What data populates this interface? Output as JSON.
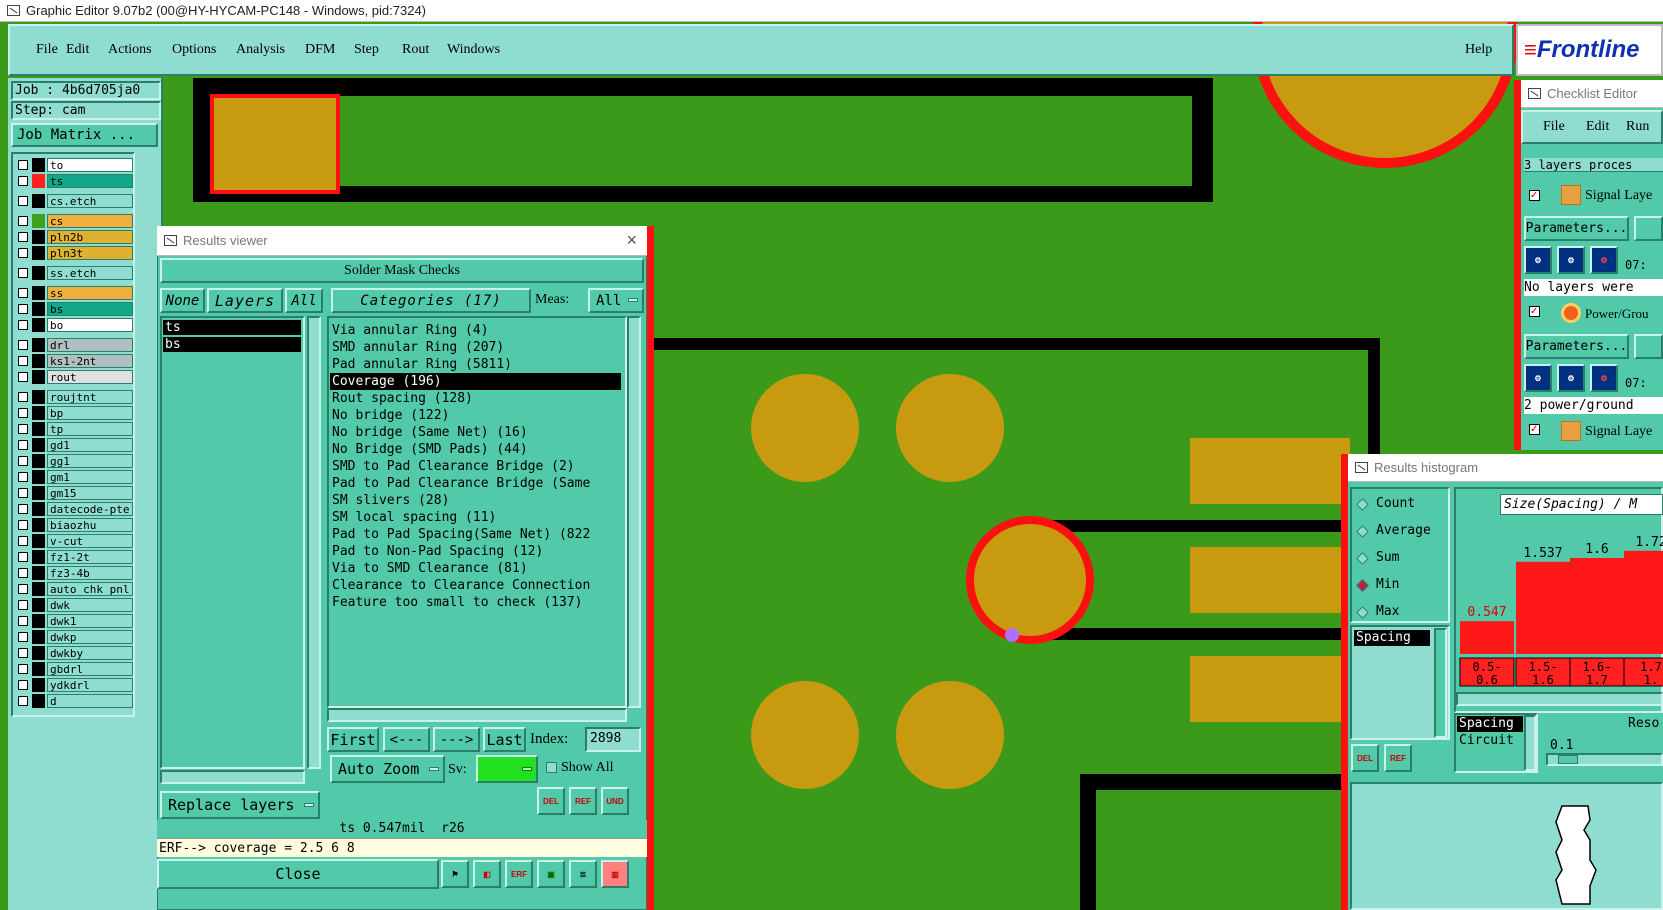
{
  "window_title": "Graphic Editor 9.07b2 (00@HY-HYCAM-PC148 - Windows, pid:7324)",
  "menu": [
    "File",
    "Edit",
    "Actions",
    "Options",
    "Analysis",
    "DFM",
    "Step",
    "Rout",
    "Windows"
  ],
  "help": "Help",
  "brand": "Frontline",
  "job": {
    "job_label": "Job : 4b6d705ja0",
    "step_label": "Step: cam",
    "matrix_button": "Job Matrix ..."
  },
  "layers": [
    {
      "name": "to",
      "color": "#000000",
      "bg": "#ffffff"
    },
    {
      "name": "ts",
      "color": "#ff2020",
      "bg": "#10a888"
    },
    {
      "name": "cs.etch",
      "color": "#000000",
      "bg": "#8fdcd0"
    },
    {
      "name": "cs",
      "color": "#40a020",
      "bg": "#f0b040"
    },
    {
      "name": "pln2b",
      "color": "#000000",
      "bg": "#e0b030"
    },
    {
      "name": "pln3t",
      "color": "#000000",
      "bg": "#e0b030"
    },
    {
      "name": "ss.etch",
      "color": "#000000",
      "bg": "#8fdcd0"
    },
    {
      "name": "ss",
      "color": "#000000",
      "bg": "#f0b040"
    },
    {
      "name": "bs",
      "color": "#000000",
      "bg": "#10a888"
    },
    {
      "name": "bo",
      "color": "#000000",
      "bg": "#ffffff"
    },
    {
      "name": "drl",
      "color": "#000000",
      "bg": "#b0c0c0"
    },
    {
      "name": "ks1-2nt",
      "color": "#000000",
      "bg": "#b0c0c0"
    },
    {
      "name": "rout",
      "color": "#000000",
      "bg": "#e0e0e0"
    },
    {
      "name": "roujtnt",
      "color": "#000000",
      "bg": "#8fdcd0"
    },
    {
      "name": "bp",
      "color": "#000000",
      "bg": "#8fdcd0"
    },
    {
      "name": "tp",
      "color": "#000000",
      "bg": "#8fdcd0"
    },
    {
      "name": "gd1",
      "color": "#000000",
      "bg": "#8fdcd0"
    },
    {
      "name": "gg1",
      "color": "#000000",
      "bg": "#8fdcd0"
    },
    {
      "name": "gm1",
      "color": "#000000",
      "bg": "#8fdcd0"
    },
    {
      "name": "gm15",
      "color": "#000000",
      "bg": "#8fdcd0"
    },
    {
      "name": "datecode-pte",
      "color": "#000000",
      "bg": "#8fdcd0"
    },
    {
      "name": "biaozhu",
      "color": "#000000",
      "bg": "#8fdcd0"
    },
    {
      "name": "v-cut",
      "color": "#000000",
      "bg": "#8fdcd0"
    },
    {
      "name": "fz1-2t",
      "color": "#000000",
      "bg": "#8fdcd0"
    },
    {
      "name": "fz3-4b",
      "color": "#000000",
      "bg": "#8fdcd0"
    },
    {
      "name": "auto_chk_pnl",
      "color": "#000000",
      "bg": "#8fdcd0"
    },
    {
      "name": "dwk",
      "color": "#000000",
      "bg": "#8fdcd0"
    },
    {
      "name": "dwk1",
      "color": "#000000",
      "bg": "#8fdcd0"
    },
    {
      "name": "dwkp",
      "color": "#000000",
      "bg": "#8fdcd0"
    },
    {
      "name": "dwkby",
      "color": "#000000",
      "bg": "#8fdcd0"
    },
    {
      "name": "gbdrl",
      "color": "#000000",
      "bg": "#8fdcd0"
    },
    {
      "name": "ydkdrl",
      "color": "#000000",
      "bg": "#8fdcd0"
    },
    {
      "name": "d",
      "color": "#000000",
      "bg": "#8fdcd0"
    }
  ],
  "results_viewer": {
    "title": "Results viewer",
    "heading": "Solder Mask Checks",
    "none_btn": "None",
    "layers_btn": "Layers",
    "all_btn": "All",
    "categories_btn": "Categories (17)",
    "meas_label": "Meas:",
    "meas_value": "All",
    "layer_list": [
      "ts",
      "bs"
    ],
    "categories": [
      "Via annular Ring (4)",
      "SMD annular Ring (207)",
      "Pad annular Ring (5811)",
      "Coverage (196)",
      "Rout spacing (128)",
      "No bridge (122)",
      "No bridge (Same Net) (16)",
      "No Bridge (SMD Pads) (44)",
      "SMD to Pad Clearance Bridge (2)",
      "Pad to Pad Clearance Bridge (Same",
      "SM slivers (28)",
      "SM local spacing (11)",
      "Pad to Pad Spacing(Same Net) (822",
      "Pad to Non-Pad Spacing (12)",
      "Via to SMD Clearance (81)",
      "Clearance to Clearance Connection",
      "Feature too small to check (137)"
    ],
    "selected_category": "Coverage (196)",
    "first": "First",
    "prev": "<---",
    "next": "--->",
    "last": "Last",
    "index_label": "Index:",
    "index_value": "2898",
    "auto_zoom": "Auto Zoom",
    "sv_label": "Sv:",
    "show_all": "Show All",
    "replace_layers": "Replace layers",
    "status": "ts 0.547mil  r26",
    "erf": "ERF--> coverage = 2.5 6 8",
    "close": "Close"
  },
  "checklist": {
    "title": "Checklist Editor",
    "menu": [
      "File",
      "Edit",
      "Run"
    ],
    "status1": "3 layers proces",
    "item1": "Signal Laye",
    "params": "Parameters...",
    "time": "07:",
    "nolayers": "No layers were",
    "item2": "Power/Grou",
    "status2": "2 power/ground",
    "item3": "Signal Laye"
  },
  "histogram": {
    "title": "Results histogram",
    "options": [
      "Count",
      "Average",
      "Sum",
      "Min",
      "Max"
    ],
    "selected": "Min",
    "list_item": "Spacing",
    "header": "Size(Spacing) / M",
    "bars": [
      {
        "label": "0.5-\n0.6",
        "value": 0.547
      },
      {
        "label": "1.5-\n1.6",
        "value": 1.537
      },
      {
        "label": "1.6-\n1.7",
        "value": 1.6
      },
      {
        "label": "1.7\n1.",
        "value": 1.72
      }
    ],
    "bar_labels": [
      "0.547",
      "1.537",
      "1.6",
      "1.72"
    ],
    "cat_labels_top": [
      "0.5-",
      "1.5-",
      "1.6-",
      "1.7"
    ],
    "cat_labels_bot": [
      "0.6",
      "1.6",
      "1.7",
      "1."
    ],
    "spacing": "Spacing",
    "circuit": "Circuit",
    "reso": "Reso",
    "reso_val": "0.1"
  }
}
